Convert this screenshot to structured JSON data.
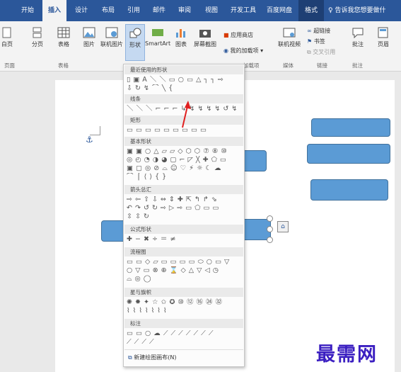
{
  "tabs": {
    "t0": "开始",
    "t1": "插入",
    "t2": "设计",
    "t3": "布局",
    "t4": "引用",
    "t5": "邮件",
    "t6": "审阅",
    "t7": "视图",
    "t8": "开发工具",
    "t9": "百度网盘",
    "t10": "格式",
    "tell": "告诉我您想要做什"
  },
  "ribbon": {
    "blank_page": "白页",
    "page_break": "分页",
    "table": "表格",
    "picture": "图片",
    "online_picture": "联机图片",
    "shapes": "形状",
    "smartart": "SmartArt",
    "chart": "图表",
    "screenshot": "屏幕截图",
    "store": "应用商店",
    "my_addins": "我的加载项",
    "online_video": "联机视频",
    "hyperlink": "超链接",
    "bookmark": "书签",
    "crossref": "交叉引用",
    "comment": "批注",
    "header": "页眉",
    "groups": {
      "pages": "页面",
      "tables": "表格",
      "addins": "加载项",
      "media": "媒体",
      "links": "链接",
      "comments": "批注"
    }
  },
  "menu": {
    "recent": "最近使用的形状",
    "lines": "线条",
    "rect": "矩形",
    "basic": "基本形状",
    "arrows": "箭头总汇",
    "equation": "公式形状",
    "flowchart": "流程图",
    "stars": "星与旗帜",
    "callouts": "标注",
    "new_canvas": "新建绘图画布(N)"
  },
  "glyphs": {
    "recent_1": "▯ ▣ A ＼ ＼ ▭ ○ ▭ △ ┐ ┐ ⇨",
    "recent_2": "⇩ ↻ ↯ ⌒ ╲ {",
    "lines_1": "＼ ＼ ＼ ⌐ ⌐ ⌐ ↳ ↯ ↯ ↯ ↯ ↺ ↯",
    "rect_1": "▭ ▭ ▭ ▭ ▭ ▭ ▭ ▭ ▭",
    "basic_1": "▣ ▣ ○ △ ▱ ▱ ◇ ⬡ ⬡ ⑦ ⑧ ⑩",
    "basic_2": "◎ ◴ ◔ ◑ ◕ ▢ ⌐ ◸ ╳ ✚ ⬠ ▭",
    "basic_3": "▣ ▢ ◎ ⊘ ⌓ ☺ ♡ ⚡ ☼ ☾ ☁",
    "basic_4": "⌒ ⎧ ⟨ ⟩ { }",
    "arrows_1": "⇨ ⇦ ⇧ ⇩ ⇔ ⇕ ✚ ⇱ ↰ ↱ ⇘",
    "arrows_2": "↶ ↷ ↺ ↻ ⇨ ▷ ⇨ ▭ ⬠ ▭ ▭",
    "arrows_3": "⇳ ⇳ ↻",
    "eq_1": "✚ − ✖ ÷ ＝ ≠",
    "flow_1": "▭ ▭ ◇ ▱ ▭ ▭ ▭ ▭ ⬭ ○ ▭ ▽",
    "flow_2": "○ ▽ ▭ ⊗ ⊕ ⌛ ◇ △ ▽ ◁ ◷",
    "flow_3": "⌓ ◎ ◯",
    "stars_1": "✺ ✹ ✦ ☆ ✩ ✪ ⑩ ⑫ ⑯ ㉔ ㉜",
    "stars_2": "⌇ ⌇ ⌇ ⌇ ⌇ ⌇ ⌇",
    "call_1": "▭ ▭ ○ ☁ ⟋ ⟋ ⟋ ⟋ ⟋ ⟋ ⟋",
    "call_2": "⟋ ⟋ ⟋ ⟋"
  },
  "watermark": "最需网",
  "colors": {
    "ribbon_blue": "#2b579a",
    "shape_fill": "#5b9bd5",
    "arrow_red": "#e02020",
    "watermark": "#3b1fc1"
  }
}
